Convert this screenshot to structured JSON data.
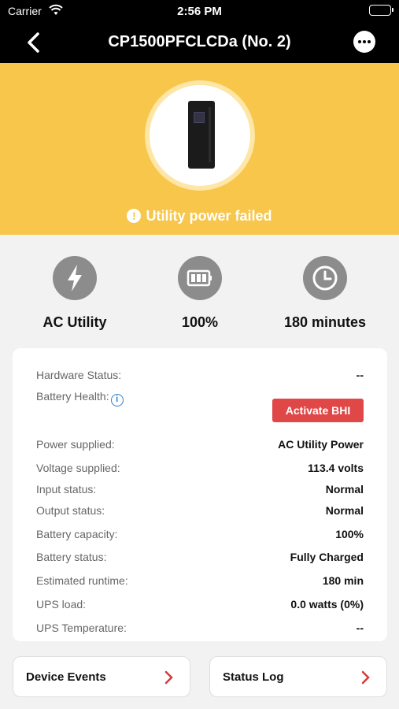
{
  "status_bar": {
    "carrier": "Carrier",
    "time": "2:56 PM"
  },
  "nav": {
    "title": "CP1500PFCLCDa (No. 2)"
  },
  "hero": {
    "alert_icon": "!",
    "alert_text": "Utility power failed"
  },
  "metrics": [
    {
      "icon": "lightning-bolt-icon",
      "label": "AC Utility"
    },
    {
      "icon": "battery-icon",
      "label": "100%"
    },
    {
      "icon": "clock-icon",
      "label": "180 minutes"
    }
  ],
  "details": {
    "hardware_status": {
      "label": "Hardware Status:",
      "value": "--"
    },
    "battery_health": {
      "label": "Battery Health:",
      "info": "i",
      "button": "Activate BHI"
    },
    "rows": [
      {
        "label": "Power supplied:",
        "value": "AC Utility Power"
      },
      {
        "label": "Voltage supplied:",
        "value": "113.4 volts"
      },
      {
        "label": "Input status:",
        "value": "Normal"
      },
      {
        "label": "Output status:",
        "value": "Normal"
      },
      {
        "label": "Battery capacity:",
        "value": "100%"
      },
      {
        "label": "Battery status:",
        "value": "Fully Charged"
      },
      {
        "label": "Estimated runtime:",
        "value": "180 min"
      },
      {
        "label": "UPS load:",
        "value": "0.0 watts (0%)"
      },
      {
        "label": "UPS Temperature:",
        "value": "--"
      }
    ]
  },
  "buttons": {
    "device_events": "Device Events",
    "status_log": "Status Log"
  },
  "colors": {
    "hero": "#f7c64a",
    "accent_red": "#e04848",
    "info_blue": "#2a7fd4",
    "chevron": "#d33b3b"
  }
}
